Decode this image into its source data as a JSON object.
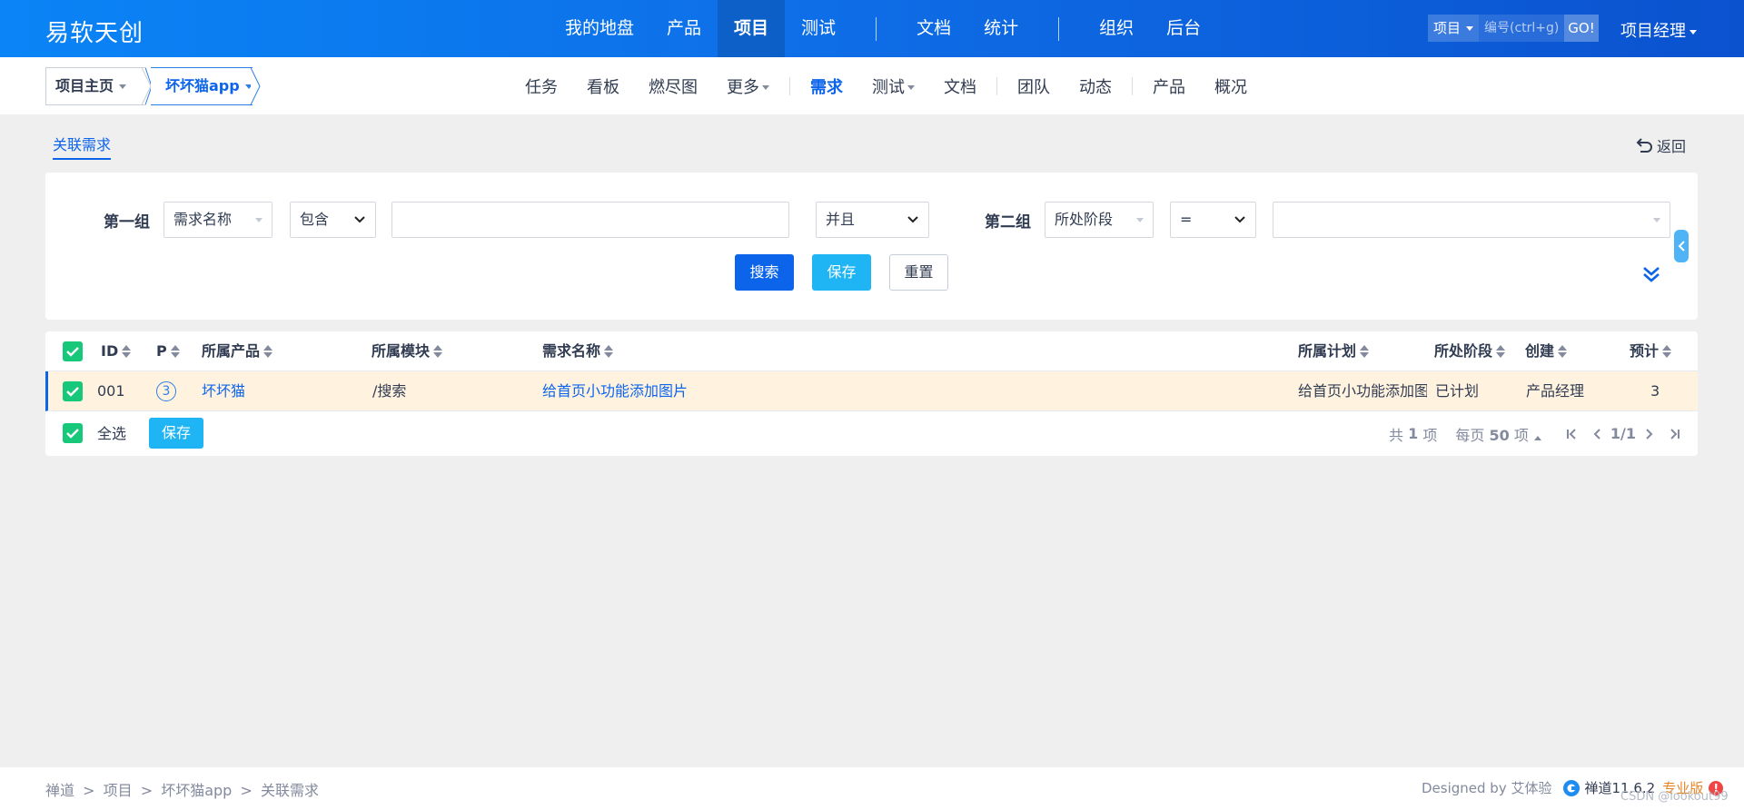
{
  "header": {
    "brand": "易软天创",
    "nav": [
      {
        "label": "我的地盘",
        "active": false
      },
      {
        "label": "产品",
        "active": false
      },
      {
        "label": "项目",
        "active": true
      },
      {
        "label": "测试",
        "active": false
      },
      {
        "label": "文档",
        "active": false
      },
      {
        "label": "统计",
        "active": false
      },
      {
        "label": "组织",
        "active": false
      },
      {
        "label": "后台",
        "active": false
      }
    ],
    "quick_search": {
      "type_label": "项目",
      "placeholder": "编号(ctrl+g)",
      "go_label": "GO!"
    },
    "user_role": "项目经理"
  },
  "subheader": {
    "crumb_home": "项目主页",
    "crumb_project": "坏坏猫app",
    "nav": [
      {
        "label": "任务"
      },
      {
        "label": "看板"
      },
      {
        "label": "燃尽图"
      },
      {
        "label": "更多"
      },
      {
        "label": "需求"
      },
      {
        "label": "测试"
      },
      {
        "label": "文档"
      },
      {
        "label": "团队"
      },
      {
        "label": "动态"
      },
      {
        "label": "产品"
      },
      {
        "label": "概况"
      }
    ]
  },
  "page": {
    "tab_label": "关联需求",
    "back_label": "返回"
  },
  "search": {
    "group1_label": "第一组",
    "group1_field": "需求名称",
    "group1_operator": "包含",
    "group1_value": "",
    "logic": "并且",
    "group2_label": "第二组",
    "group2_field": "所处阶段",
    "group2_operator": "=",
    "group2_value": "",
    "search_label": "搜索",
    "save_label": "保存",
    "reset_label": "重置"
  },
  "table": {
    "columns": [
      "ID",
      "P",
      "所属产品",
      "所属模块",
      "需求名称",
      "所属计划",
      "所处阶段",
      "创建",
      "预计"
    ],
    "rows": [
      {
        "id": "001",
        "pri": "3",
        "product": "坏坏猫",
        "module": "/搜索",
        "title": "给首页小功能添加图片",
        "plan": "给首页小功能添加图",
        "stage": "已计划",
        "creator": "产品经理",
        "estimate": "3"
      }
    ],
    "select_all_label": "全选",
    "save_label": "保存",
    "pager": {
      "total_prefix": "共",
      "total": "1",
      "total_suffix": "项",
      "per_prefix": "每页",
      "per_page": "50",
      "per_suffix": "项",
      "page": "1/1"
    }
  },
  "footer": {
    "crumbs": [
      "禅道",
      ">",
      "项目",
      ">",
      "坏坏猫app",
      ">",
      "关联需求"
    ],
    "designed_by": "Designed by 艾体验",
    "version": "禅道11.6.2",
    "edition": "专业版",
    "watermark": "CSDN @lookout99"
  },
  "colors": {
    "primary": "#0c64eb",
    "accent": "#1fb5f5",
    "check": "#17c77a",
    "row_highlight": "#fff3e0"
  }
}
